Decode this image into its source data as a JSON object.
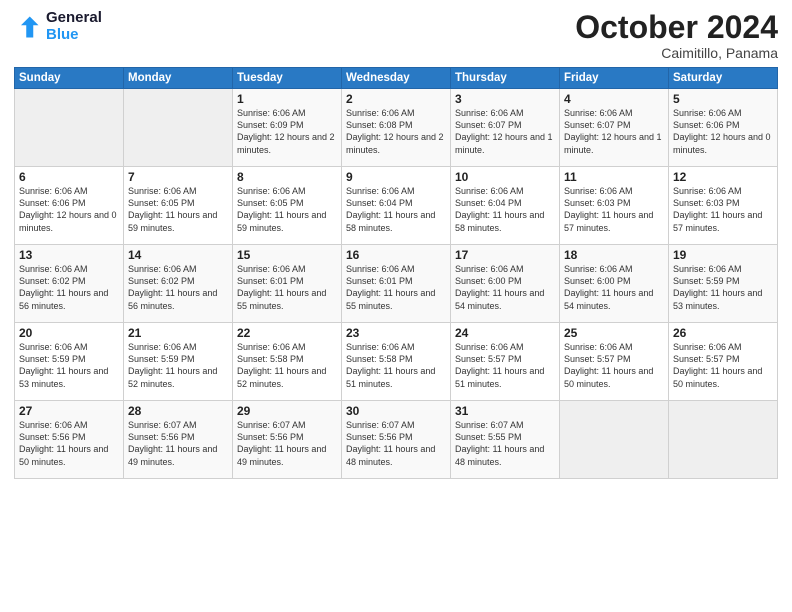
{
  "header": {
    "logo_line1": "General",
    "logo_line2": "Blue",
    "month": "October 2024",
    "location": "Caimitillo, Panama"
  },
  "days_of_week": [
    "Sunday",
    "Monday",
    "Tuesday",
    "Wednesday",
    "Thursday",
    "Friday",
    "Saturday"
  ],
  "weeks": [
    [
      {
        "day": "",
        "empty": true
      },
      {
        "day": "",
        "empty": true
      },
      {
        "day": "1",
        "sunrise": "Sunrise: 6:06 AM",
        "sunset": "Sunset: 6:09 PM",
        "daylight": "Daylight: 12 hours and 2 minutes."
      },
      {
        "day": "2",
        "sunrise": "Sunrise: 6:06 AM",
        "sunset": "Sunset: 6:08 PM",
        "daylight": "Daylight: 12 hours and 2 minutes."
      },
      {
        "day": "3",
        "sunrise": "Sunrise: 6:06 AM",
        "sunset": "Sunset: 6:07 PM",
        "daylight": "Daylight: 12 hours and 1 minute."
      },
      {
        "day": "4",
        "sunrise": "Sunrise: 6:06 AM",
        "sunset": "Sunset: 6:07 PM",
        "daylight": "Daylight: 12 hours and 1 minute."
      },
      {
        "day": "5",
        "sunrise": "Sunrise: 6:06 AM",
        "sunset": "Sunset: 6:06 PM",
        "daylight": "Daylight: 12 hours and 0 minutes."
      }
    ],
    [
      {
        "day": "6",
        "sunrise": "Sunrise: 6:06 AM",
        "sunset": "Sunset: 6:06 PM",
        "daylight": "Daylight: 12 hours and 0 minutes."
      },
      {
        "day": "7",
        "sunrise": "Sunrise: 6:06 AM",
        "sunset": "Sunset: 6:05 PM",
        "daylight": "Daylight: 11 hours and 59 minutes."
      },
      {
        "day": "8",
        "sunrise": "Sunrise: 6:06 AM",
        "sunset": "Sunset: 6:05 PM",
        "daylight": "Daylight: 11 hours and 59 minutes."
      },
      {
        "day": "9",
        "sunrise": "Sunrise: 6:06 AM",
        "sunset": "Sunset: 6:04 PM",
        "daylight": "Daylight: 11 hours and 58 minutes."
      },
      {
        "day": "10",
        "sunrise": "Sunrise: 6:06 AM",
        "sunset": "Sunset: 6:04 PM",
        "daylight": "Daylight: 11 hours and 58 minutes."
      },
      {
        "day": "11",
        "sunrise": "Sunrise: 6:06 AM",
        "sunset": "Sunset: 6:03 PM",
        "daylight": "Daylight: 11 hours and 57 minutes."
      },
      {
        "day": "12",
        "sunrise": "Sunrise: 6:06 AM",
        "sunset": "Sunset: 6:03 PM",
        "daylight": "Daylight: 11 hours and 57 minutes."
      }
    ],
    [
      {
        "day": "13",
        "sunrise": "Sunrise: 6:06 AM",
        "sunset": "Sunset: 6:02 PM",
        "daylight": "Daylight: 11 hours and 56 minutes."
      },
      {
        "day": "14",
        "sunrise": "Sunrise: 6:06 AM",
        "sunset": "Sunset: 6:02 PM",
        "daylight": "Daylight: 11 hours and 56 minutes."
      },
      {
        "day": "15",
        "sunrise": "Sunrise: 6:06 AM",
        "sunset": "Sunset: 6:01 PM",
        "daylight": "Daylight: 11 hours and 55 minutes."
      },
      {
        "day": "16",
        "sunrise": "Sunrise: 6:06 AM",
        "sunset": "Sunset: 6:01 PM",
        "daylight": "Daylight: 11 hours and 55 minutes."
      },
      {
        "day": "17",
        "sunrise": "Sunrise: 6:06 AM",
        "sunset": "Sunset: 6:00 PM",
        "daylight": "Daylight: 11 hours and 54 minutes."
      },
      {
        "day": "18",
        "sunrise": "Sunrise: 6:06 AM",
        "sunset": "Sunset: 6:00 PM",
        "daylight": "Daylight: 11 hours and 54 minutes."
      },
      {
        "day": "19",
        "sunrise": "Sunrise: 6:06 AM",
        "sunset": "Sunset: 5:59 PM",
        "daylight": "Daylight: 11 hours and 53 minutes."
      }
    ],
    [
      {
        "day": "20",
        "sunrise": "Sunrise: 6:06 AM",
        "sunset": "Sunset: 5:59 PM",
        "daylight": "Daylight: 11 hours and 53 minutes."
      },
      {
        "day": "21",
        "sunrise": "Sunrise: 6:06 AM",
        "sunset": "Sunset: 5:59 PM",
        "daylight": "Daylight: 11 hours and 52 minutes."
      },
      {
        "day": "22",
        "sunrise": "Sunrise: 6:06 AM",
        "sunset": "Sunset: 5:58 PM",
        "daylight": "Daylight: 11 hours and 52 minutes."
      },
      {
        "day": "23",
        "sunrise": "Sunrise: 6:06 AM",
        "sunset": "Sunset: 5:58 PM",
        "daylight": "Daylight: 11 hours and 51 minutes."
      },
      {
        "day": "24",
        "sunrise": "Sunrise: 6:06 AM",
        "sunset": "Sunset: 5:57 PM",
        "daylight": "Daylight: 11 hours and 51 minutes."
      },
      {
        "day": "25",
        "sunrise": "Sunrise: 6:06 AM",
        "sunset": "Sunset: 5:57 PM",
        "daylight": "Daylight: 11 hours and 50 minutes."
      },
      {
        "day": "26",
        "sunrise": "Sunrise: 6:06 AM",
        "sunset": "Sunset: 5:57 PM",
        "daylight": "Daylight: 11 hours and 50 minutes."
      }
    ],
    [
      {
        "day": "27",
        "sunrise": "Sunrise: 6:06 AM",
        "sunset": "Sunset: 5:56 PM",
        "daylight": "Daylight: 11 hours and 50 minutes."
      },
      {
        "day": "28",
        "sunrise": "Sunrise: 6:07 AM",
        "sunset": "Sunset: 5:56 PM",
        "daylight": "Daylight: 11 hours and 49 minutes."
      },
      {
        "day": "29",
        "sunrise": "Sunrise: 6:07 AM",
        "sunset": "Sunset: 5:56 PM",
        "daylight": "Daylight: 11 hours and 49 minutes."
      },
      {
        "day": "30",
        "sunrise": "Sunrise: 6:07 AM",
        "sunset": "Sunset: 5:56 PM",
        "daylight": "Daylight: 11 hours and 48 minutes."
      },
      {
        "day": "31",
        "sunrise": "Sunrise: 6:07 AM",
        "sunset": "Sunset: 5:55 PM",
        "daylight": "Daylight: 11 hours and 48 minutes."
      },
      {
        "day": "",
        "empty": true
      },
      {
        "day": "",
        "empty": true
      }
    ]
  ]
}
